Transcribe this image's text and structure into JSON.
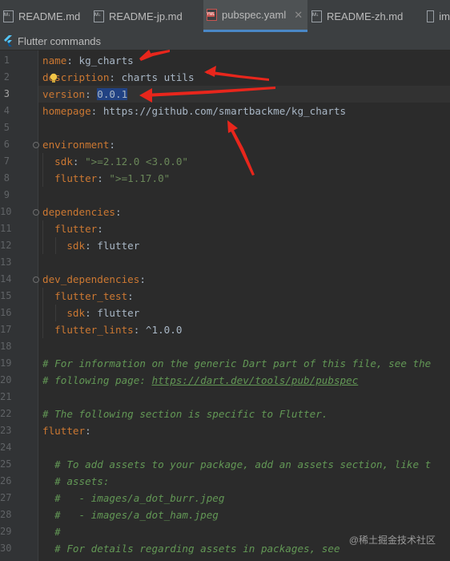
{
  "tabs": [
    {
      "label": "README.md",
      "icon": "markdown-file-icon",
      "active": false
    },
    {
      "label": "README-jp.md",
      "icon": "markdown-file-icon",
      "active": false
    },
    {
      "label": "pubspec.yaml",
      "icon": "yaml-file-icon",
      "active": true
    },
    {
      "label": "README-zh.md",
      "icon": "markdown-file-icon",
      "active": false
    },
    {
      "label": "im",
      "icon": "file-icon",
      "active": false
    }
  ],
  "toolbar": {
    "label": "Flutter commands",
    "icon": "flutter-icon"
  },
  "editor": {
    "current_line": 3,
    "line_numbers": [
      "1",
      "2",
      "3",
      "4",
      "5",
      "6",
      "7",
      "8",
      "9",
      "10",
      "11",
      "12",
      "13",
      "14",
      "15",
      "16",
      "17",
      "18",
      "19",
      "20",
      "21",
      "22",
      "23",
      "24",
      "25",
      "26",
      "27",
      "28",
      "29",
      "30"
    ],
    "l1": {
      "key": "name",
      "value": "kg_charts"
    },
    "l2": {
      "key_a": "de",
      "key_b": "scription",
      "value": "charts utils"
    },
    "l3": {
      "key": "version",
      "value": "0.0.1"
    },
    "l4": {
      "key": "homepage",
      "value": "https://github.com/smartbackme/kg_charts"
    },
    "l6": {
      "key": "environment"
    },
    "l7": {
      "key": "sdk",
      "value": "\">=2.12.0 <3.0.0\""
    },
    "l8": {
      "key": "flutter",
      "value": "\">=1.17.0\""
    },
    "l10": {
      "key": "dependencies"
    },
    "l11": {
      "key": "flutter"
    },
    "l12": {
      "key": "sdk",
      "value": "flutter"
    },
    "l14": {
      "key": "dev_dependencies"
    },
    "l15": {
      "key": "flutter_test"
    },
    "l16": {
      "key": "sdk",
      "value": "flutter"
    },
    "l17": {
      "key": "flutter_lints",
      "value": "^1.0.0"
    },
    "l19": "# For information on the generic Dart part of this file, see the",
    "l20": {
      "text": "# following page: ",
      "link": "https://dart.dev/tools/pub/pubspec"
    },
    "l22": "# The following section is specific to Flutter.",
    "l23": {
      "key": "flutter"
    },
    "l25": "# To add assets to your package, add an assets section, like t",
    "l26": "# assets:",
    "l27": "#   - images/a_dot_burr.jpeg",
    "l28": "#   - images/a_dot_ham.jpeg",
    "l29": "#",
    "l30": "# For details regarding assets in packages, see"
  },
  "colors": {
    "annotation_arrow": "#e8261c",
    "keyword": "#cc7832",
    "string": "#6a8759",
    "comment": "#629755"
  },
  "watermark": "@稀土掘金技术社区"
}
